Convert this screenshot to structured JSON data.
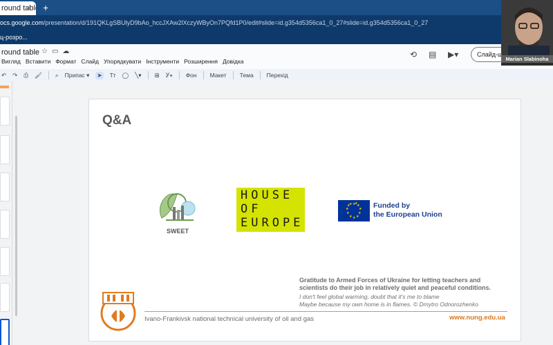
{
  "browser": {
    "tab_title": "round table",
    "tab_close": "×",
    "new_tab": "+",
    "url_domain": "ocs.google.com",
    "url_path": "/presentation/d/191QKLgSBUlyD9bAo_hccJXAw2lXczyWByOn7PQfd1P0/edit#slide=id.g354d5356ca1_0_27#slide=id.g354d5356ca1_0_27",
    "bookmark_label": "ц-розро..."
  },
  "doc": {
    "title": "round table",
    "menu": [
      "Вигляд",
      "Вставити",
      "Формат",
      "Слайд",
      "Упорядкувати",
      "Інструменти",
      "Розширення",
      "Довідка"
    ],
    "slideshow_label": "Слайд-ш"
  },
  "toolbar": {
    "snap_label": "Припас",
    "background_label": "Фон",
    "layout_label": "Макет",
    "theme_label": "Тема",
    "transition_label": "Перехід"
  },
  "slide": {
    "heading": "Q&A",
    "sweet_label": "SWEET",
    "hoe_rows": [
      "HOUSE",
      "OF",
      "EUROPE"
    ],
    "eu_line1": "Funded by",
    "eu_line2": "the European Union",
    "gratitude": "Gratitude to Armed Forces of Ukraine for letting teachers and scientists do their job in relatively quiet and peaceful conditions.",
    "quote_line1": "I don't feel global warming, doubt that it's me to blame",
    "quote_line2": "Maybe because my own home is in flames. © Dmytro Odnorozhenko",
    "university": "Ivano-Frankivsk national technical university of oil and gas",
    "website": "www.nung.edu.ua"
  },
  "participant": {
    "name": "Marian Slabinoha"
  },
  "colors": {
    "hoe_yellow": "#d4e400",
    "eu_blue": "#003399",
    "nung_orange": "#d77a1e"
  }
}
